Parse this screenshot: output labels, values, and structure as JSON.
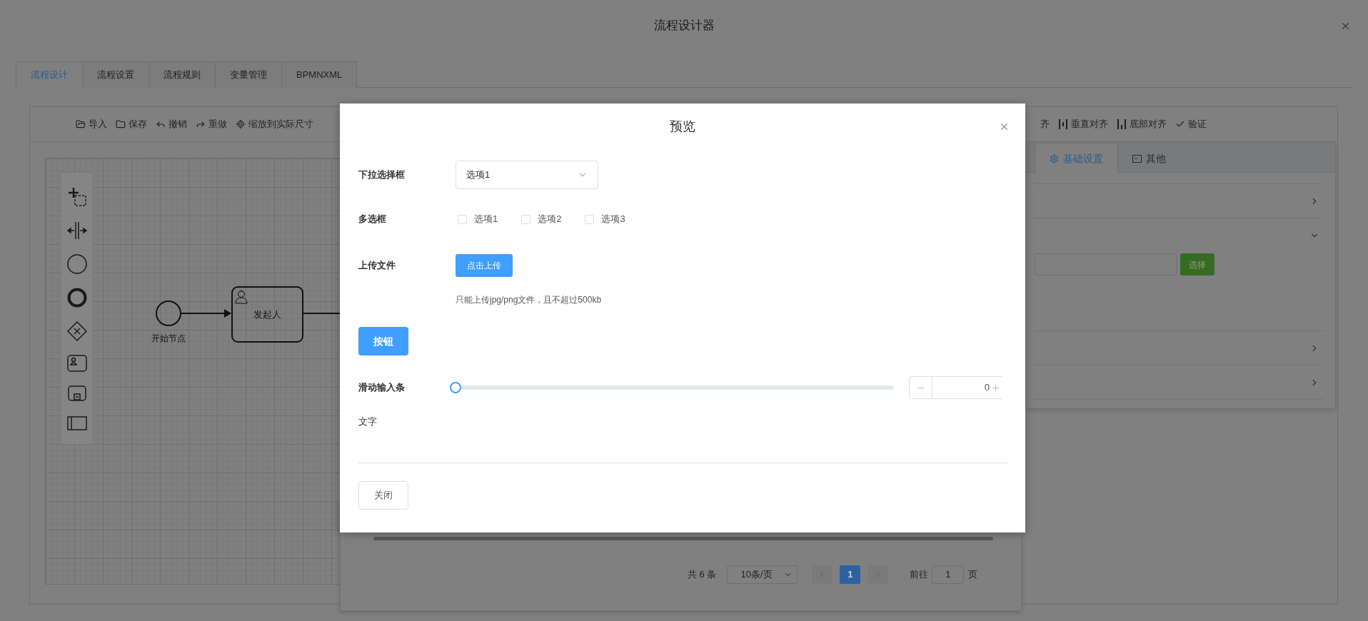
{
  "window": {
    "title": "流程设计器"
  },
  "tabs": [
    {
      "label": "流程设计",
      "selected": true
    },
    {
      "label": "流程设置",
      "selected": false
    },
    {
      "label": "流程规则",
      "selected": false
    },
    {
      "label": "变量管理",
      "selected": false
    },
    {
      "label": "BPMNXML",
      "selected": false
    }
  ],
  "toolbar": {
    "left": [
      {
        "kind": "import",
        "label": "导入"
      },
      {
        "kind": "save",
        "label": "保存"
      },
      {
        "kind": "undo",
        "label": "撤销"
      },
      {
        "kind": "redo",
        "label": "重做"
      },
      {
        "kind": "zoom",
        "label": "缩放到实际尺寸"
      }
    ],
    "right": [
      {
        "kind": "plain",
        "label": "齐"
      },
      {
        "kind": "align-vertical",
        "label": "垂直对齐"
      },
      {
        "kind": "align-bottom",
        "label": "底部对齐"
      },
      {
        "kind": "validate",
        "label": "验证"
      }
    ]
  },
  "diagram": {
    "nodes": [
      {
        "kind": "start",
        "label": "开始节点"
      },
      {
        "kind": "user-task",
        "label": "发起人"
      }
    ]
  },
  "properties": {
    "tabs": [
      {
        "kind": "gear",
        "label": "基础设置",
        "selected": true
      },
      {
        "kind": "card",
        "label": "其他",
        "selected": false
      }
    ],
    "sections": [
      {
        "expanded": false
      },
      {
        "expanded": true,
        "button": "选择"
      },
      {
        "expanded": false
      },
      {
        "expanded": false
      }
    ]
  },
  "pagination": {
    "total": "共 6 条",
    "page_size": "10条/页",
    "pages": [
      {
        "label": "1",
        "selected": true
      }
    ],
    "goto_label": "前往",
    "goto_value": "1",
    "goto_suffix": "页"
  },
  "preview": {
    "title": "预览",
    "fields": [
      {
        "kind": "select",
        "label": "下拉选择框",
        "value": "选项1"
      },
      {
        "kind": "checkboxes",
        "label": "多选框",
        "options": [
          {
            "label": "选项1",
            "checked": false
          },
          {
            "label": "选项2",
            "checked": false
          },
          {
            "label": "选项3",
            "checked": false
          }
        ]
      },
      {
        "kind": "upload",
        "label": "上传文件",
        "button": "点击上传",
        "tip": "只能上传jpg/png文件，且不超过500kb"
      },
      {
        "kind": "button",
        "button": "按钮"
      },
      {
        "kind": "slider",
        "label": "滑动输入条",
        "level": 0,
        "value": "0"
      },
      {
        "kind": "text",
        "label": "文字"
      }
    ],
    "footer_button": "关闭"
  }
}
